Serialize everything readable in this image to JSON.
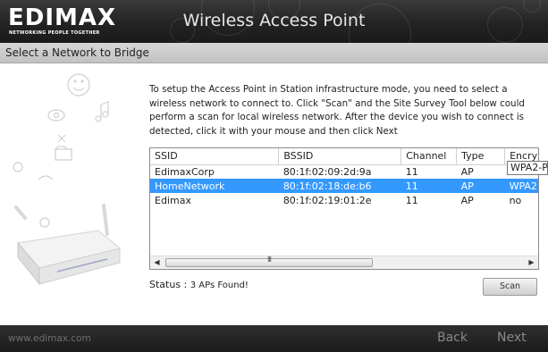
{
  "header": {
    "logo_text": "EDIMAX",
    "logo_tagline": "NETWORKING PEOPLE TOGETHER",
    "title": "Wireless Access Point"
  },
  "subheader": {
    "title": "Select a Network to Bridge"
  },
  "instructions": "To setup the Access Point in Station infrastructure mode, you need to select a wireless network to connect to. Click \"Scan\" and the Site Survey Tool below could perform a scan for local wireless network. After the device you wish to connect is detected, click it with your mouse and then click Next",
  "table": {
    "columns": [
      "SSID",
      "BSSID",
      "Channel",
      "Type",
      "Encry"
    ],
    "rows": [
      [
        "EdimaxCorp",
        "80:1f:02:09:2d:9a",
        "11",
        "AP",
        ""
      ],
      [
        "HomeNetwork",
        "80:1f:02:18:de:b6",
        "11",
        "AP",
        "WPA2"
      ],
      [
        "Edimax",
        "80:1f:02:19:01:2e",
        "11",
        "AP",
        "no"
      ]
    ],
    "selected_row": 1,
    "tooltip": "WPA2-P",
    "scrollbar_grip": "III"
  },
  "status": {
    "label": "Status :",
    "value": "3 APs Found!"
  },
  "scan_button": "Scan",
  "footer": {
    "url": "www.edimax.com",
    "back": "Back",
    "next": "Next"
  },
  "colors": {
    "selection": "#3399ff",
    "header_bg": "#232323",
    "footer_text": "#8a8a8a"
  }
}
